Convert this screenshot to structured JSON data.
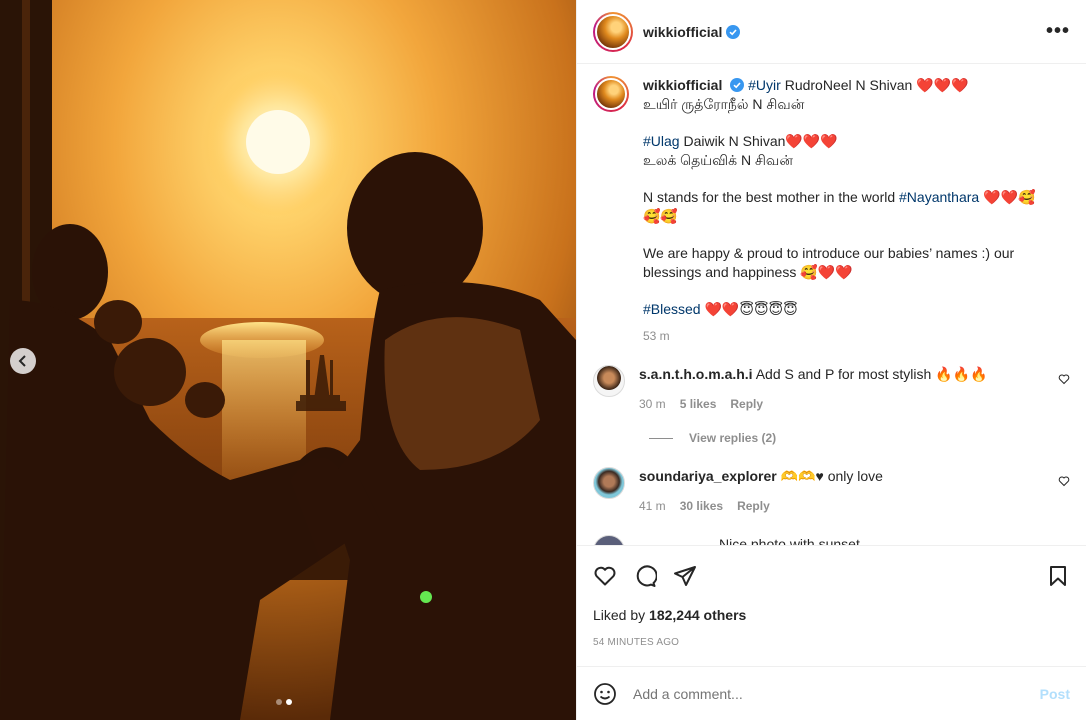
{
  "post": {
    "username": "wikkiofficial",
    "more_icon": "more-horizontal-icon",
    "caption": {
      "line1_tag": "#Uyir",
      "line1_text": " RudroNeel N Shivan ",
      "line1_hearts": "❤️❤️❤️",
      "line2": "உயிர் ருத்ரோநீல் N சிவன்",
      "line3_tag": "#Ulag",
      "line3_text": " Daiwik N Shivan",
      "line3_hearts": "❤️❤️❤️",
      "line4": "உலக் தெய்விக் N சிவன்",
      "line5_text": "N stands for the best mother in the world ",
      "line5_tag": "#Nayanthara",
      "line5_emoji": " ❤️❤️🥰",
      "line5_emoji2": "🥰🥰",
      "line6": "We are happy & proud to introduce our babies’ names :) our blessings and happiness ",
      "line6_emoji": "🥰❤️❤️",
      "line7_tag": "#Blessed",
      "line7_emoji": " ❤️❤️😇😇😇😇",
      "time": "53 m"
    },
    "comments": [
      {
        "username": "s.a.n.t.h.o.m.a.h.i",
        "text": " Add S and P for most stylish 🔥🔥🔥",
        "time": "30 m",
        "likes": "5 likes",
        "reply": "Reply",
        "view_replies": "View replies (2)"
      },
      {
        "username": "soundariya_explorer",
        "text": " 🫶🫶♥ only love",
        "time": "41 m",
        "likes": "30 likes",
        "reply": "Reply"
      },
      {
        "username": "",
        "text": "Nice photo with sunset"
      }
    ],
    "liked_by_prefix": "Liked by ",
    "liked_by_count": "182,244 others",
    "time_ago": "54 MINUTES AGO",
    "add_comment_placeholder": "Add a comment...",
    "post_label": "Post"
  },
  "carousel": {
    "slide_count": 2,
    "active_index": 1
  },
  "colors": {
    "link": "#00376b",
    "muted": "#8e8e8e",
    "heart": "#e0162b",
    "post_disabled": "#b2dffc",
    "verified": "#3897f0"
  }
}
